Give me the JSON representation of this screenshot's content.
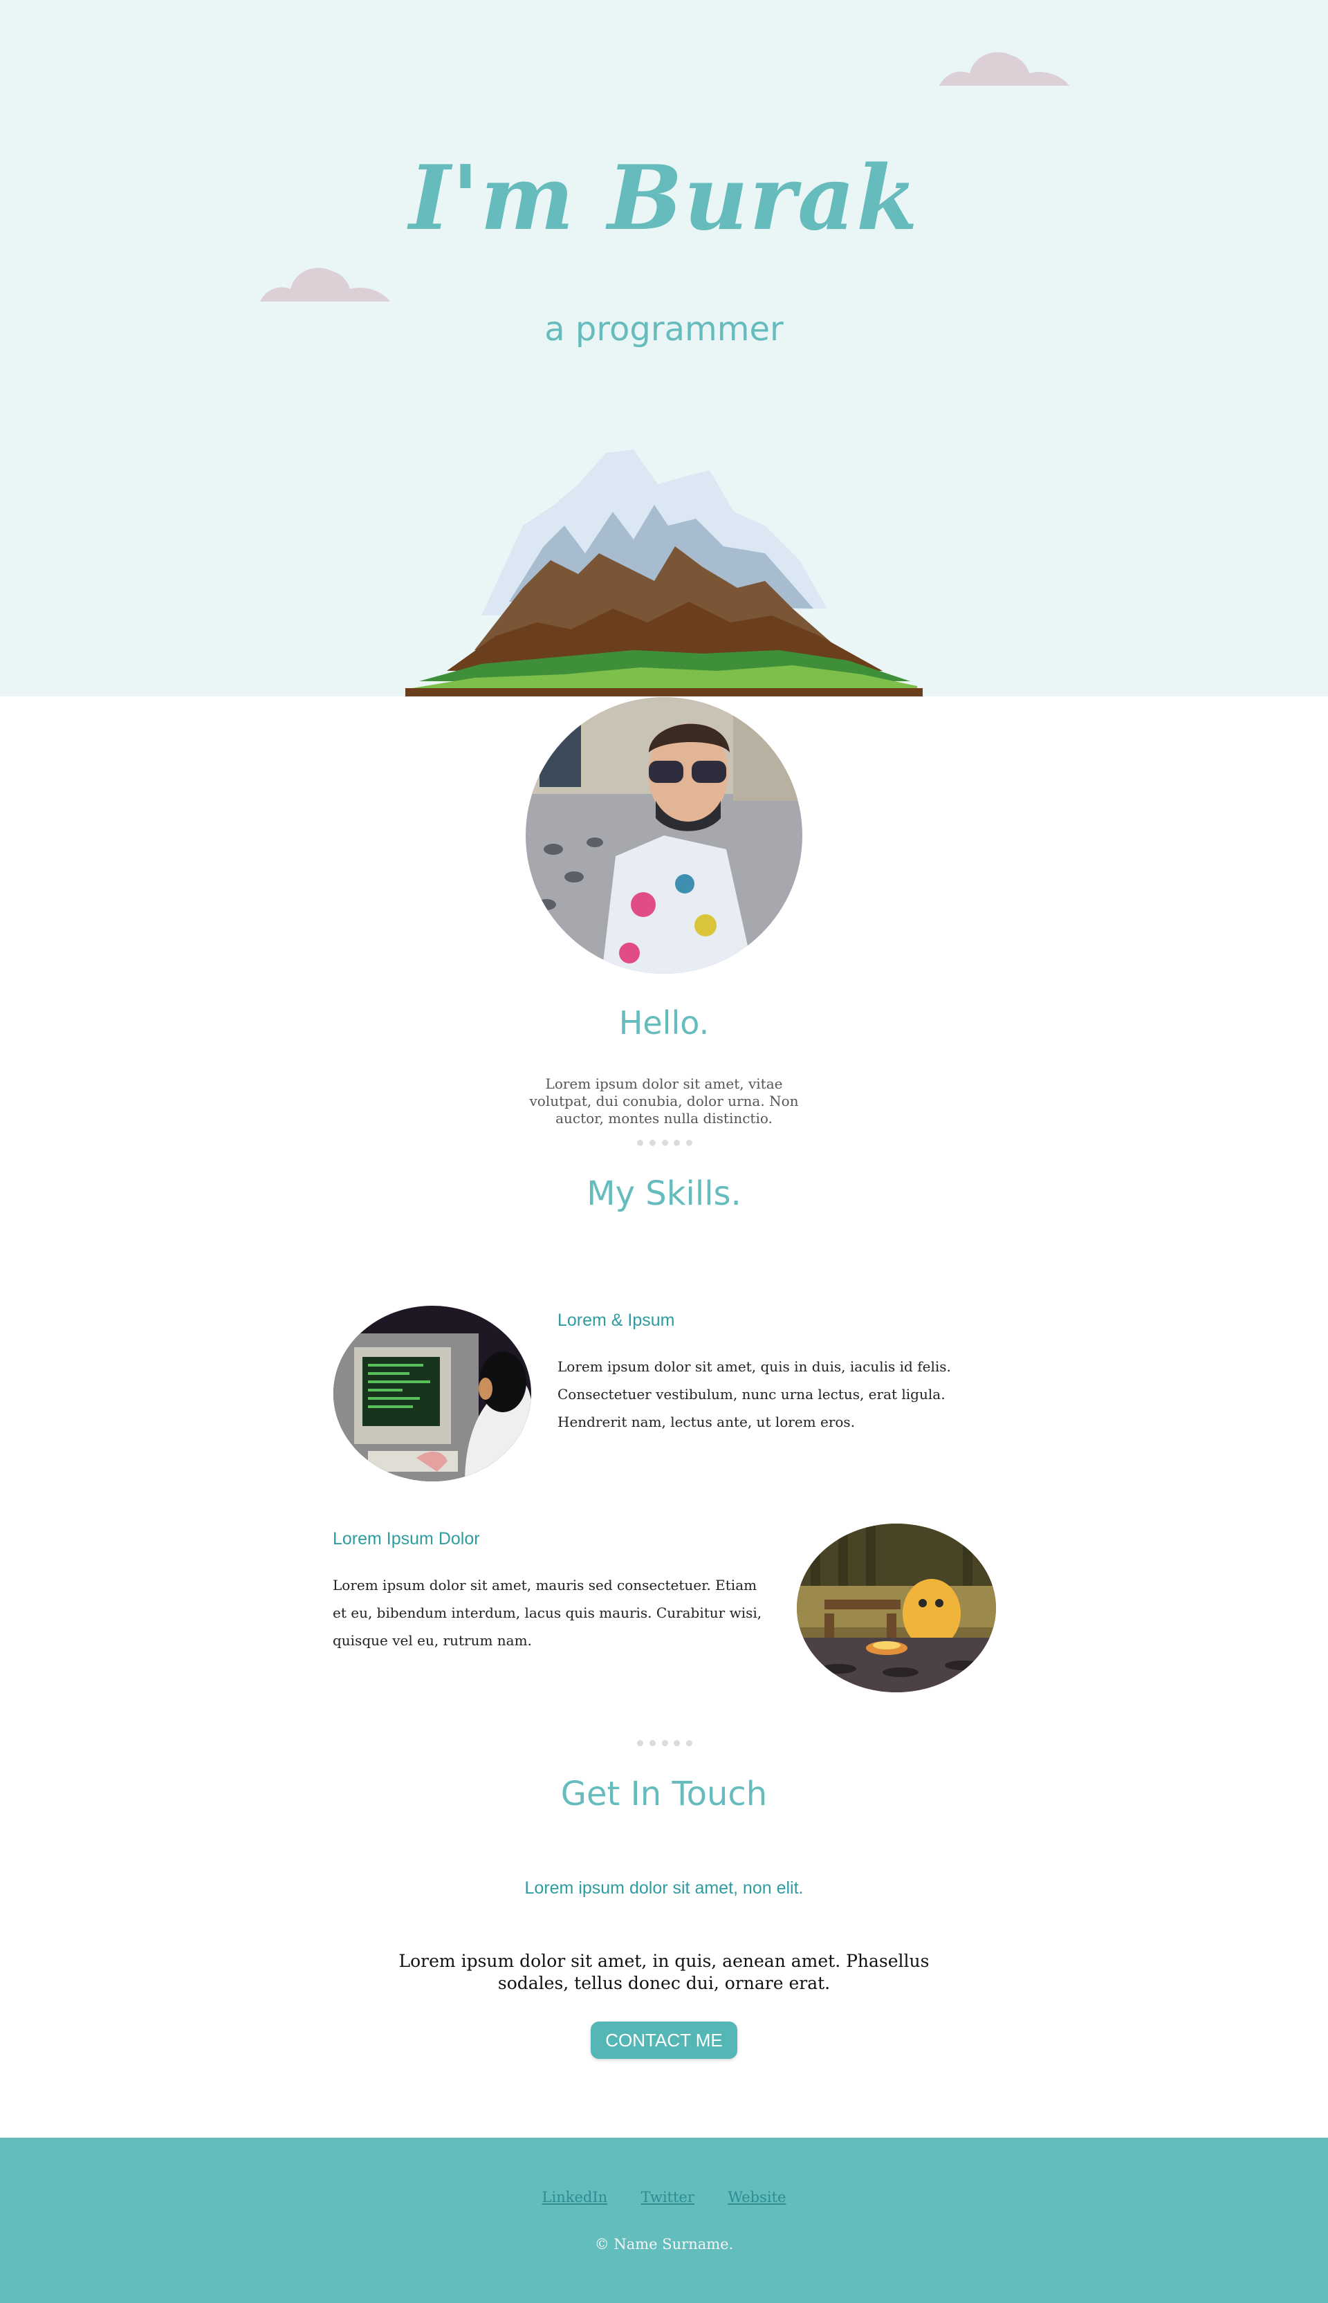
{
  "hero": {
    "title": "I'm Burak",
    "subtitle": "a programmer"
  },
  "about": {
    "heading": "Hello.",
    "text": "Lorem ipsum dolor sit amet, vitae volutpat, dui conubia, dolor urna. Non auctor, montes nulla distinctio."
  },
  "skills": {
    "heading": "My Skills.",
    "items": [
      {
        "title": "Lorem & Ipsum",
        "text": "Lorem ipsum dolor sit amet, quis in duis, iaculis id felis. Consectetuer vestibulum, nunc urna lectus, erat ligula. Hendrerit nam, lectus ante, ut lorem eros."
      },
      {
        "title": "Lorem Ipsum Dolor",
        "text": "Lorem ipsum dolor sit amet, mauris sed consectetuer. Etiam et eu, bibendum interdum, lacus quis mauris. Curabitur wisi, quisque vel eu, rutrum nam."
      }
    ]
  },
  "contact": {
    "heading": "Get In Touch",
    "subheading": "Lorem ipsum dolor sit amet, non elit.",
    "text": "Lorem ipsum dolor sit amet, in quis, aenean amet. Phasellus sodales, tellus donec dui, ornare erat.",
    "button_label": "CONTACT ME"
  },
  "footer": {
    "links": [
      "LinkedIn",
      "Twitter",
      "Website"
    ],
    "copyright": "© Name Surname."
  },
  "colors": {
    "accent": "#66bcbc",
    "hero_bg": "#eaf6f6",
    "footer_bg": "#64bdbd",
    "cloud": "#dccfd5"
  }
}
